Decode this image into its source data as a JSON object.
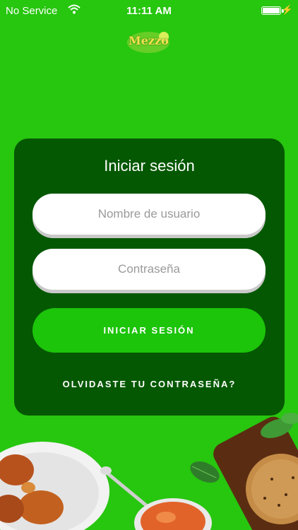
{
  "status_bar": {
    "carrier": "No Service",
    "time": "11:11 AM"
  },
  "logo": {
    "text": "Mezzo"
  },
  "login": {
    "title": "Iniciar sesión",
    "username_placeholder": "Nombre de usuario",
    "password_placeholder": "Contraseña",
    "submit_label": "INICIAR SESIÓN",
    "forgot_label": "OLVIDASTE TU CONTRASEÑA?"
  },
  "colors": {
    "background": "#27c60f",
    "card": "#055802",
    "button": "#1cc40a"
  }
}
